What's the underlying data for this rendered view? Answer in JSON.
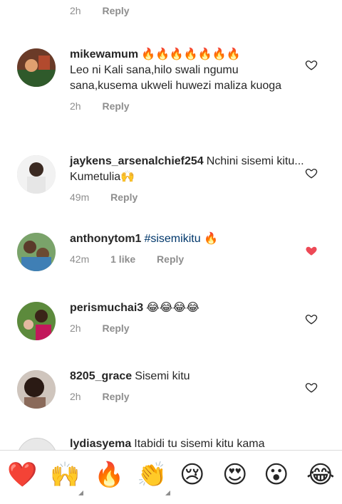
{
  "top": {
    "time": "2h",
    "reply": "Reply"
  },
  "comments": [
    {
      "username": "mikewamum",
      "text": "🔥🔥🔥🔥🔥🔥🔥",
      "text2": "Leo ni Kali sana,hilo swali ngumu sana,kusema ukweli huwezi maliza kuoga",
      "time": "2h",
      "reply": "Reply"
    },
    {
      "username": "jaykens_arsenalchief254",
      "text": "Nchini sisemi kitu... Kumetulia🙌",
      "time": "49m",
      "reply": "Reply"
    },
    {
      "username": "anthonytom1",
      "text": "#sisemikitu",
      "emoji": "🔥",
      "time": "42m",
      "likes": "1 like",
      "reply": "Reply",
      "liked": true
    },
    {
      "username": "perismuchai3",
      "text": "😂😂😂😂",
      "time": "2h",
      "reply": "Reply"
    },
    {
      "username": "8205_grace",
      "text": "Sisemi kitu",
      "time": "2h",
      "reply": "Reply"
    },
    {
      "username": "lydiasyema",
      "text": "Itabidi tu sisemi kitu kama"
    }
  ],
  "quick_reactions": [
    "❤️",
    "🙌",
    "🔥",
    "👏",
    "😢",
    "😍",
    "😮",
    "😂"
  ],
  "colors": {
    "liked_heart": "#ed4956",
    "muted": "#8e8e8e",
    "hashtag": "#00376b"
  }
}
